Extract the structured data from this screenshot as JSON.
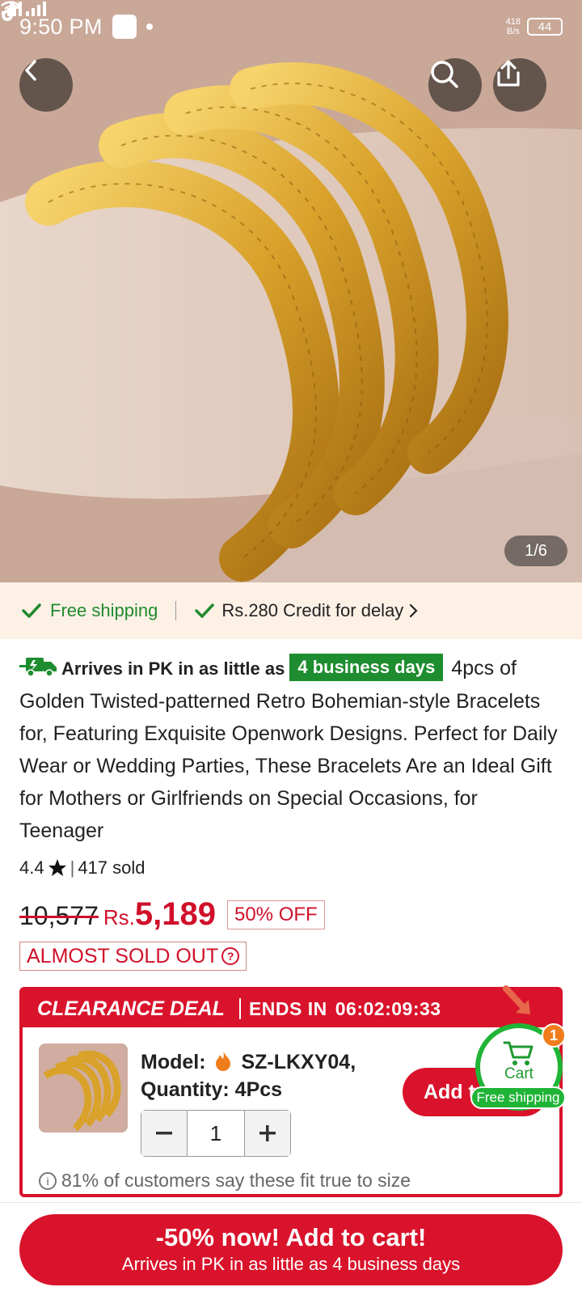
{
  "status_bar": {
    "time": "9:50 PM",
    "net_speed_value": "418",
    "net_speed_unit": "B/s",
    "battery": "44"
  },
  "gallery": {
    "counter": "1/6"
  },
  "shipping_strip": {
    "free_shipping": "Free shipping",
    "credit": "Rs.280 Credit for delay",
    "check_color": "#1f8a2e"
  },
  "product": {
    "arrive_prefix": "Arrives in PK in as little as",
    "arrive_days": "4 business days",
    "title": "4pcs of Golden Twisted-patterned Retro Bohemian-style Bracelets for, Featuring Exquisite Openwork Designs. Perfect for Daily Wear or Wedding Parties, These Bracelets Are an Ideal Gift for Mothers or Girlfriends on Special Occasions, for Teenager",
    "rating": "4.4",
    "sold": "417 sold",
    "old_price": "10,577",
    "currency": "Rs.",
    "price": "5,189",
    "discount": "50% OFF",
    "stock_label": "ALMOST SOLD OUT"
  },
  "clearance": {
    "title": "CLEARANCE DEAL",
    "ends_label": "ENDS IN",
    "countdown": "06:02:09:33",
    "model_label": "Model:",
    "model_value": "SZ-LKXY04,",
    "quantity_line": "Quantity: 4Pcs",
    "quantity": "1",
    "add_button": "Add to cart",
    "fit_note": "81% of customers say these fit true to size"
  },
  "floating_cart": {
    "label": "Cart",
    "badge": "1",
    "shipping_tag": "Free shipping"
  },
  "cta": {
    "main": "-50% now! Add to cart!",
    "sub": "Arrives in PK in as little as 4 business days"
  },
  "colors": {
    "brand_red": "#d9132b",
    "green": "#1e8d2f",
    "orange": "#f07c1b"
  }
}
